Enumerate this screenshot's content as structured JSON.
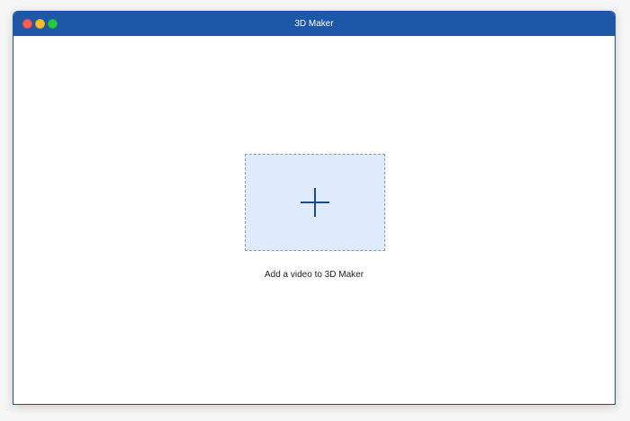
{
  "window": {
    "title": "3D Maker"
  },
  "main": {
    "dropzone_icon": "plus-icon",
    "hint": "Add a video to 3D Maker"
  },
  "colors": {
    "titlebar": "#1c57a8",
    "dropzone_fill": "#deebfd",
    "dropzone_border": "#8a9bb5",
    "icon": "#1e4a88"
  }
}
